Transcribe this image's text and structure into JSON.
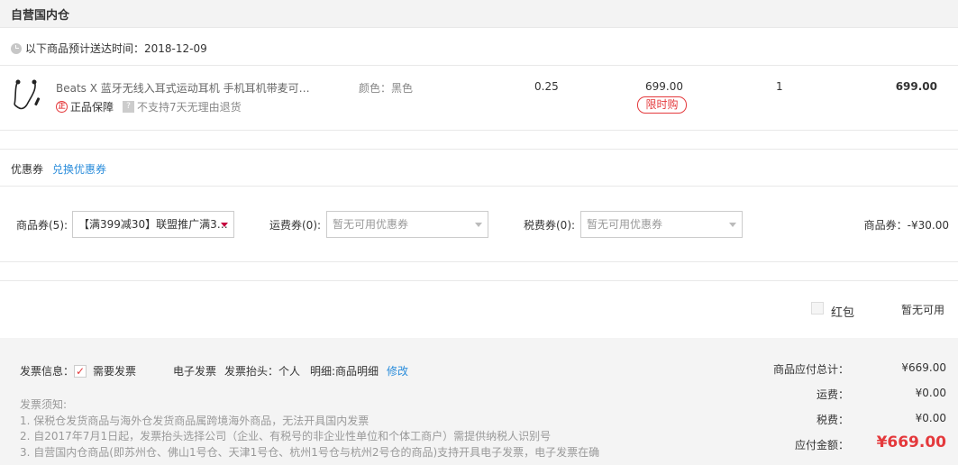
{
  "section": {
    "title": "自营国内仓"
  },
  "delivery": {
    "text": "以下商品预计送达时间：2018-12-09"
  },
  "product": {
    "name": "Beats X 蓝牙无线入耳式运动耳机 手机耳机带麦可…",
    "guarantee": "正品保障",
    "no_return": "不支持7天无理由退货",
    "color": "颜色：黑色",
    "weight": "0.25",
    "price": "699.00",
    "flash_tag": "限时购",
    "qty": "1",
    "subtotal": "699.00"
  },
  "coupon": {
    "title": "优惠券",
    "exchange_link": "兑换优惠券",
    "goods_label": "商品券(5):",
    "goods_value": "【满399减30】联盟推广满3…",
    "shipping_label": "运费券(0):",
    "shipping_value": "暂无可用优惠券",
    "tax_label": "税费券(0):",
    "tax_value": "暂无可用优惠券",
    "summary": "商品券：-¥30.00"
  },
  "redpack": {
    "label": "红包",
    "status": "暂无可用"
  },
  "invoice": {
    "label": "发票信息：",
    "need": "需要发票",
    "type": "电子发票",
    "head": "发票抬头：个人",
    "detail": "明细:商品明细",
    "edit": "修改",
    "notes_title": "发票须知:",
    "notes": [
      "1. 保税仓发货商品与海外仓发货商品属跨境海外商品，无法开具国内发票",
      "2. 自2017年7月1日起，发票抬头选择公司（企业、有税号的非企业性单位和个体工商户）需提供纳税人识别号",
      "3. 自营国内仓商品(即苏州仓、佛山1号仓、天津1号仓、杭州1号仓与杭州2号仓的商品)支持开具电子发票，电子发票在确"
    ]
  },
  "summary": {
    "goods_total_label": "商品应付总计：",
    "goods_total": "¥669.00",
    "shipping_label": "运费：",
    "shipping": "¥0.00",
    "tax_label": "税费：",
    "tax": "¥0.00",
    "payable_label": "应付金额：",
    "payable": "¥669.00"
  },
  "colors": {
    "accent_red": "#e4393c",
    "link_blue": "#2b8ddb"
  }
}
